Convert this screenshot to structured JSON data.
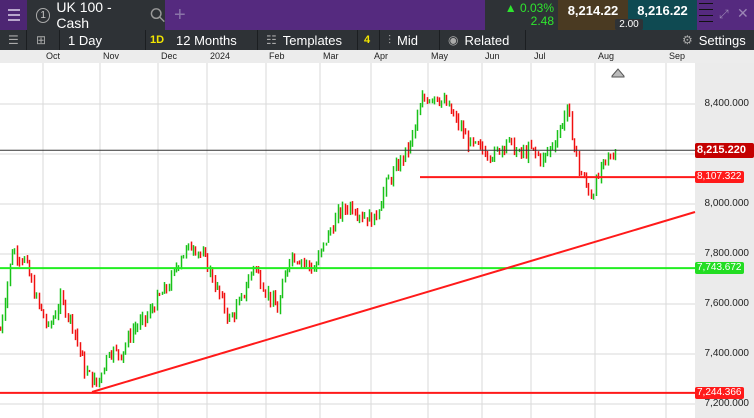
{
  "tab": {
    "number": "1",
    "title": "UK 100 - Cash"
  },
  "quote": {
    "change_pct": "0.03%",
    "change_pts": "2.48",
    "bid": "8,214.22",
    "ask": "8,216.22",
    "spread": "2.00"
  },
  "toolbar": {
    "interval": "1 Day",
    "interval_badge": "1D",
    "range": "12 Months",
    "templates": "Templates",
    "templates_count": "4",
    "price_type": "Mid",
    "related": "Related",
    "settings": "Settings"
  },
  "months": [
    "Oct",
    "Nov",
    "Dec",
    "2024",
    "Feb",
    "Mar",
    "Apr",
    "May",
    "Jun",
    "Jul",
    "Aug",
    "Sep"
  ],
  "y_labels": [
    "8,400.000",
    "8,000.000",
    "7,800.000",
    "7,600.000",
    "7,400.000",
    "7,200.000"
  ],
  "colors": {
    "up": "#19c219",
    "down": "#f01010",
    "brand": "#552a7f"
  },
  "chart_data": {
    "type": "ohlc",
    "ylim": [
      7160,
      8550
    ],
    "current_price": "8,215.220",
    "levels": [
      {
        "label": "8,107.322",
        "value": 8107.322,
        "color": "#ff1a1a"
      },
      {
        "label": "7,743.672",
        "value": 7743.672,
        "color": "#22ee22"
      },
      {
        "label": "7,244.366",
        "value": 7244.366,
        "color": "#ff1a1a"
      }
    ],
    "trendline": {
      "from": 7244,
      "to": 7968,
      "color": "#ff1a1a"
    },
    "weekly_closes": [
      7496,
      7816,
      7776,
      7616,
      7500,
      7616,
      7520,
      7336,
      7276,
      7416,
      7400,
      7500,
      7536,
      7616,
      7676,
      7796,
      7836,
      7776,
      7656,
      7536,
      7616,
      7756,
      7656,
      7576,
      7796,
      7776,
      7736,
      7856,
      7956,
      7996,
      7956,
      7936,
      8076,
      8156,
      8236,
      8416,
      8436,
      8396,
      8316,
      8236,
      8216,
      8196,
      8256,
      8196,
      8216,
      8176,
      8256,
      8376,
      8136,
      8036,
      8156,
      8215
    ]
  }
}
